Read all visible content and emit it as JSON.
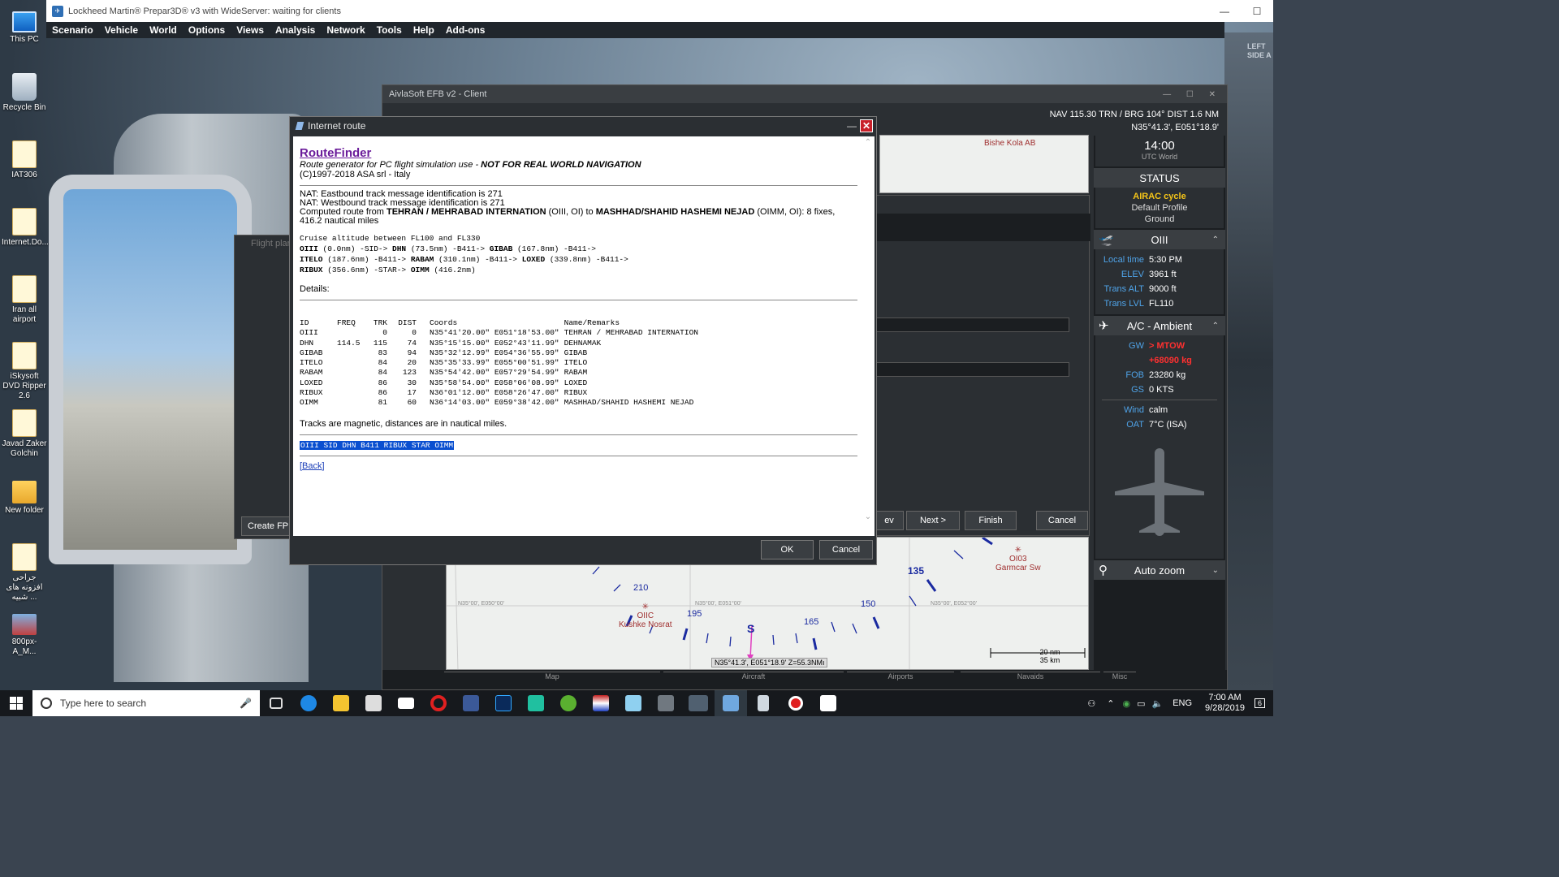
{
  "desktop": {
    "icons": [
      {
        "label": "This PC"
      },
      {
        "label": "Recycle Bin"
      },
      {
        "label": "IAT306"
      },
      {
        "label": "Internet.Do..."
      },
      {
        "label": "Iran all airport"
      },
      {
        "label": "iSkysoft DVD Ripper 2.6"
      },
      {
        "label": "Javad Zaker Golchin"
      },
      {
        "label": "New folder"
      },
      {
        "label": "جراحی افزونه های شبیه ..."
      },
      {
        "label": "800px-A_M..."
      }
    ]
  },
  "background": {
    "side_label_1": "LEFT",
    "side_label_2": "SIDE A"
  },
  "p3d": {
    "title": "Lockheed Martin® Prepar3D® v3 with WideServer: waiting for clients",
    "window_controls": [
      "—",
      "☐"
    ],
    "menu": [
      "Scenario",
      "Vehicle",
      "World",
      "Options",
      "Views",
      "Analysis",
      "Network",
      "Tools",
      "Help",
      "Add-ons"
    ]
  },
  "efb": {
    "title": "AivlaSoft EFB v2 - Client",
    "nav_line1": "NAV 115.30 TRN / BRG 104°  DIST 1.6 NM",
    "nav_line2": "N35°41.3', E051°18.9'",
    "map_top_label": "Bishe Kola AB",
    "map": {
      "labels": [
        "210",
        "195",
        "165",
        "150",
        "135",
        "S"
      ],
      "grid": [
        "N35°00', E050°00'",
        "N35°00', E051°00'",
        "N35°00', E052°00'"
      ],
      "airport1_code": "OIIC",
      "airport1_name": "Kushke Nosrat",
      "airport2_code": "OI03",
      "airport2_name": "Garmcar Sw",
      "scale_nm": "20 nm",
      "scale_km": "35 km",
      "cursor": "N35°41.3', E051°18.9'  Z=55.3NMı"
    },
    "side": {
      "time": "14:00",
      "zone": "UTC World",
      "status_header": "STATUS",
      "airac": "AIRAC cycle",
      "profile": "Default Profile",
      "phase": "Ground",
      "airport_header": "OIII",
      "airport_rows": [
        {
          "k": "Local time",
          "v": "5:30 PM"
        },
        {
          "k": "ELEV",
          "v": "3961 ft"
        },
        {
          "k": "Trans ALT",
          "v": "9000 ft"
        },
        {
          "k": "Trans LVL",
          "v": "FL110"
        }
      ],
      "ac_header": "A/C - Ambient",
      "gw_key": "GW",
      "gw_val1": "> MTOW",
      "gw_val2": "+68090 kg",
      "ac_rows": [
        {
          "k": "FOB",
          "v": "23280 kg"
        },
        {
          "k": "GS",
          "v": "0 KTS"
        }
      ],
      "wind_rows": [
        {
          "k": "Wind",
          "v": "calm"
        },
        {
          "k": "OAT",
          "v": "7°C (ISA)"
        }
      ],
      "zoom_header": "Auto zoom"
    },
    "wizard": {
      "prev": "ev",
      "next": "Next >",
      "finish": "Finish",
      "cancel": "Cancel"
    },
    "bottom_groups": [
      "Map",
      "Aircraft",
      "Airports",
      "Navaids",
      "Misc"
    ]
  },
  "flight_plan": {
    "title": "Flight plar",
    "create": "Create FPL"
  },
  "dialog": {
    "title": "Internet route",
    "min": "—",
    "close": "✕",
    "rf_title": "RouteFinder",
    "rf_sub": "Route generator for PC flight simulation use - ",
    "rf_sub_bold": "NOT FOR REAL WORLD NAVIGATION",
    "rf_copy": "(C)1997-2018 ASA srl - Italy",
    "nat1": "NAT: Eastbound track message identification is 271",
    "nat2": "NAT: Westbound track message identification is 271",
    "computed_pre": "Computed route from ",
    "from_name": "TEHRAN / MEHRABAD INTERNATION",
    "from_code": " (OIII, OI) to ",
    "to_name": "MASHHAD/SHAHID HASHEMI NEJAD",
    "to_code": " (OIMM, OI): 8 fixes,",
    "computed_tail": "416.2 nautical miles",
    "cruise": "Cruise altitude between FL100 and FL330",
    "route_lines": [
      [
        {
          "b": "OIII"
        },
        {
          "t": " (0.0nm) -SID-> "
        },
        {
          "b": "DHN"
        },
        {
          "t": " (73.5nm) -B411-> "
        },
        {
          "b": "GIBAB"
        },
        {
          "t": " (167.8nm) -B411->"
        }
      ],
      [
        {
          "b": "ITELO"
        },
        {
          "t": " (187.6nm) -B411-> "
        },
        {
          "b": "RABAM"
        },
        {
          "t": " (310.1nm) -B411-> "
        },
        {
          "b": "LOXED"
        },
        {
          "t": " (339.8nm) -B411->"
        }
      ],
      [
        {
          "b": "RIBUX"
        },
        {
          "t": " (356.6nm) -STAR-> "
        },
        {
          "b": "OIMM"
        },
        {
          "t": " (416.2nm)"
        }
      ]
    ],
    "details": "Details:",
    "table_headers": [
      "ID",
      "FREQ",
      "TRK",
      "DIST",
      "Coords",
      "Name/Remarks"
    ],
    "fixes": [
      [
        "OIII",
        "",
        "0",
        "0",
        "N35°41'20.00\" E051°18'53.00\"",
        "TEHRAN / MEHRABAD INTERNATION"
      ],
      [
        "DHN",
        "114.5",
        "115",
        "74",
        "N35°15'15.00\" E052°43'11.99\"",
        "DEHNAMAK"
      ],
      [
        "GIBAB",
        "",
        "83",
        "94",
        "N35°32'12.99\" E054°36'55.99\"",
        "GIBAB"
      ],
      [
        "ITELO",
        "",
        "84",
        "20",
        "N35°35'33.99\" E055°00'51.99\"",
        "ITELO"
      ],
      [
        "RABAM",
        "",
        "84",
        "123",
        "N35°54'42.00\" E057°29'54.99\"",
        "RABAM"
      ],
      [
        "LOXED",
        "",
        "86",
        "30",
        "N35°58'54.00\" E058°06'08.99\"",
        "LOXED"
      ],
      [
        "RIBUX",
        "",
        "86",
        "17",
        "N36°01'12.00\" E058°26'47.00\"",
        "RIBUX"
      ],
      [
        "OIMM",
        "",
        "81",
        "60",
        "N36°14'03.00\" E059°38'42.00\"",
        "MASHHAD/SHAHID HASHEMI NEJAD"
      ]
    ],
    "tracks_note": "Tracks are magnetic, distances are in nautical miles.",
    "route_string": "OIII SID DHN B411 RIBUX STAR OIMM",
    "back": "[Back]",
    "ok": "OK",
    "cancel": "Cancel"
  },
  "taskbar": {
    "search_placeholder": "Type here to search",
    "lang": "ENG",
    "time": "7:00 AM",
    "date": "9/28/2019",
    "notif": "6"
  }
}
